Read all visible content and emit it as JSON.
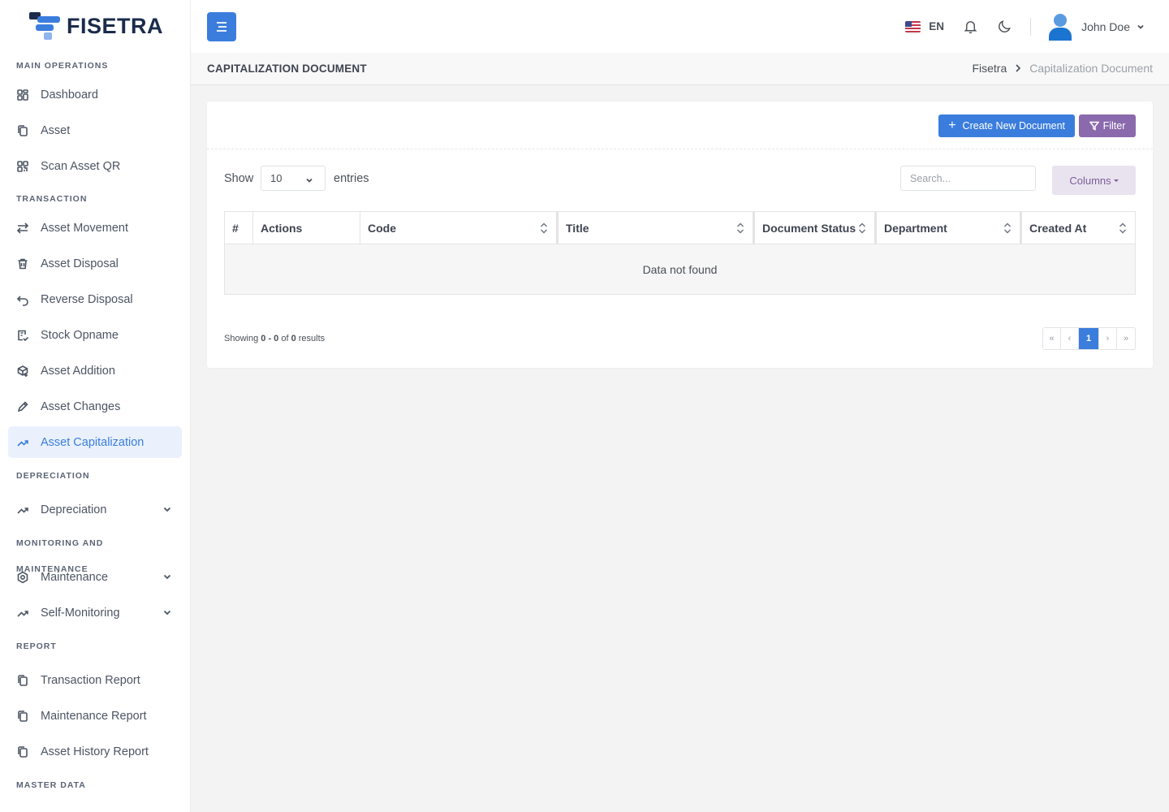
{
  "brand": {
    "name": "FISETRA"
  },
  "sidebar": {
    "sections": [
      {
        "title": "MAIN OPERATIONS"
      },
      {
        "title": "TRANSACTION"
      },
      {
        "title": "DEPRECIATION"
      },
      {
        "title": "MONITORING AND MAINTENANCE"
      },
      {
        "title": "REPORT"
      },
      {
        "title": "MASTER DATA"
      }
    ],
    "items": [
      {
        "label": "Dashboard",
        "icon": "dashboard-icon"
      },
      {
        "label": "Asset",
        "icon": "copy-icon"
      },
      {
        "label": "Scan Asset QR",
        "icon": "qr-icon"
      },
      {
        "label": "Asset Movement",
        "icon": "arrows-icon"
      },
      {
        "label": "Asset Disposal",
        "icon": "trash-icon"
      },
      {
        "label": "Reverse Disposal",
        "icon": "undo-icon"
      },
      {
        "label": "Stock Opname",
        "icon": "clipboard-check-icon"
      },
      {
        "label": "Asset Addition",
        "icon": "box-plus-icon"
      },
      {
        "label": "Asset Changes",
        "icon": "pencil-icon"
      },
      {
        "label": "Asset Capitalization",
        "icon": "trending-up-icon",
        "active": true
      },
      {
        "label": "Depreciation",
        "icon": "trending-up-icon",
        "expandable": true
      },
      {
        "label": "Maintenance",
        "icon": "gear-icon",
        "expandable": true
      },
      {
        "label": "Self-Monitoring",
        "icon": "trending-up-icon",
        "expandable": true
      },
      {
        "label": "Transaction Report",
        "icon": "copy-icon"
      },
      {
        "label": "Maintenance Report",
        "icon": "copy-icon"
      },
      {
        "label": "Asset History Report",
        "icon": "copy-icon"
      }
    ]
  },
  "topbar": {
    "language": "EN",
    "user_name": "John Doe"
  },
  "page": {
    "title": "CAPITALIZATION DOCUMENT",
    "breadcrumb": {
      "home": "Fisetra",
      "current": "Capitalization Document"
    }
  },
  "card": {
    "create_button": "Create New Document",
    "filter_button": "Filter",
    "show_label": "Show",
    "page_size": "10",
    "entries_label": "entries",
    "search_placeholder": "Search...",
    "columns_button": "Columns",
    "table": {
      "headers": [
        "#",
        "Actions",
        "Code",
        "Title",
        "Document Status",
        "Department",
        "Created At"
      ],
      "empty_message": "Data not found"
    },
    "footer": {
      "showing_prefix": "Showing ",
      "range": "0 - 0",
      "of": " of ",
      "total": "0",
      "suffix": " results"
    },
    "pagination": {
      "first": "«",
      "prev": "‹",
      "current": "1",
      "next": "›",
      "last": "»"
    }
  },
  "colors": {
    "primary": "#3b7ddd",
    "filter": "#8a6aac",
    "columns_bg": "#e9e3ef",
    "active_bg": "#eaf1fd"
  }
}
